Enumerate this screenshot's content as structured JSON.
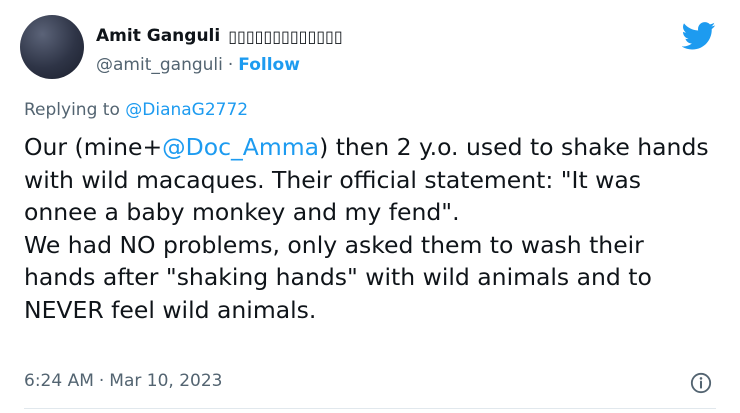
{
  "tweet": {
    "author": {
      "display_name": "Amit Ganguli",
      "name_suffix": "▯▯▯▯▯▯▯▯▯▯▯▯▯",
      "handle": "@amit_ganguli",
      "separator": "·",
      "follow_label": "Follow"
    },
    "replying": {
      "prefix": "Replying to ",
      "target": "@DianaG2772"
    },
    "body": {
      "p1_before": "Our (mine+",
      "p1_mention": "@Doc_Amma",
      "p1_after": ") then 2 y.o. used to shake hands with wild macaques. Their official statement: \"It was onnee a baby monkey and my fend\".",
      "p2": "We had NO problems, only asked them to wash their hands after \"shaking hands\" with wild animals and to NEVER feel wild animals."
    },
    "meta": {
      "time": "6:24 AM",
      "separator": "·",
      "date": "Mar 10, 2023"
    },
    "icons": {
      "logo": "twitter-bird-icon",
      "info": "info-icon"
    },
    "colors": {
      "accent": "#1d9bf0",
      "text": "#0f1419",
      "secondary": "#536471"
    }
  }
}
